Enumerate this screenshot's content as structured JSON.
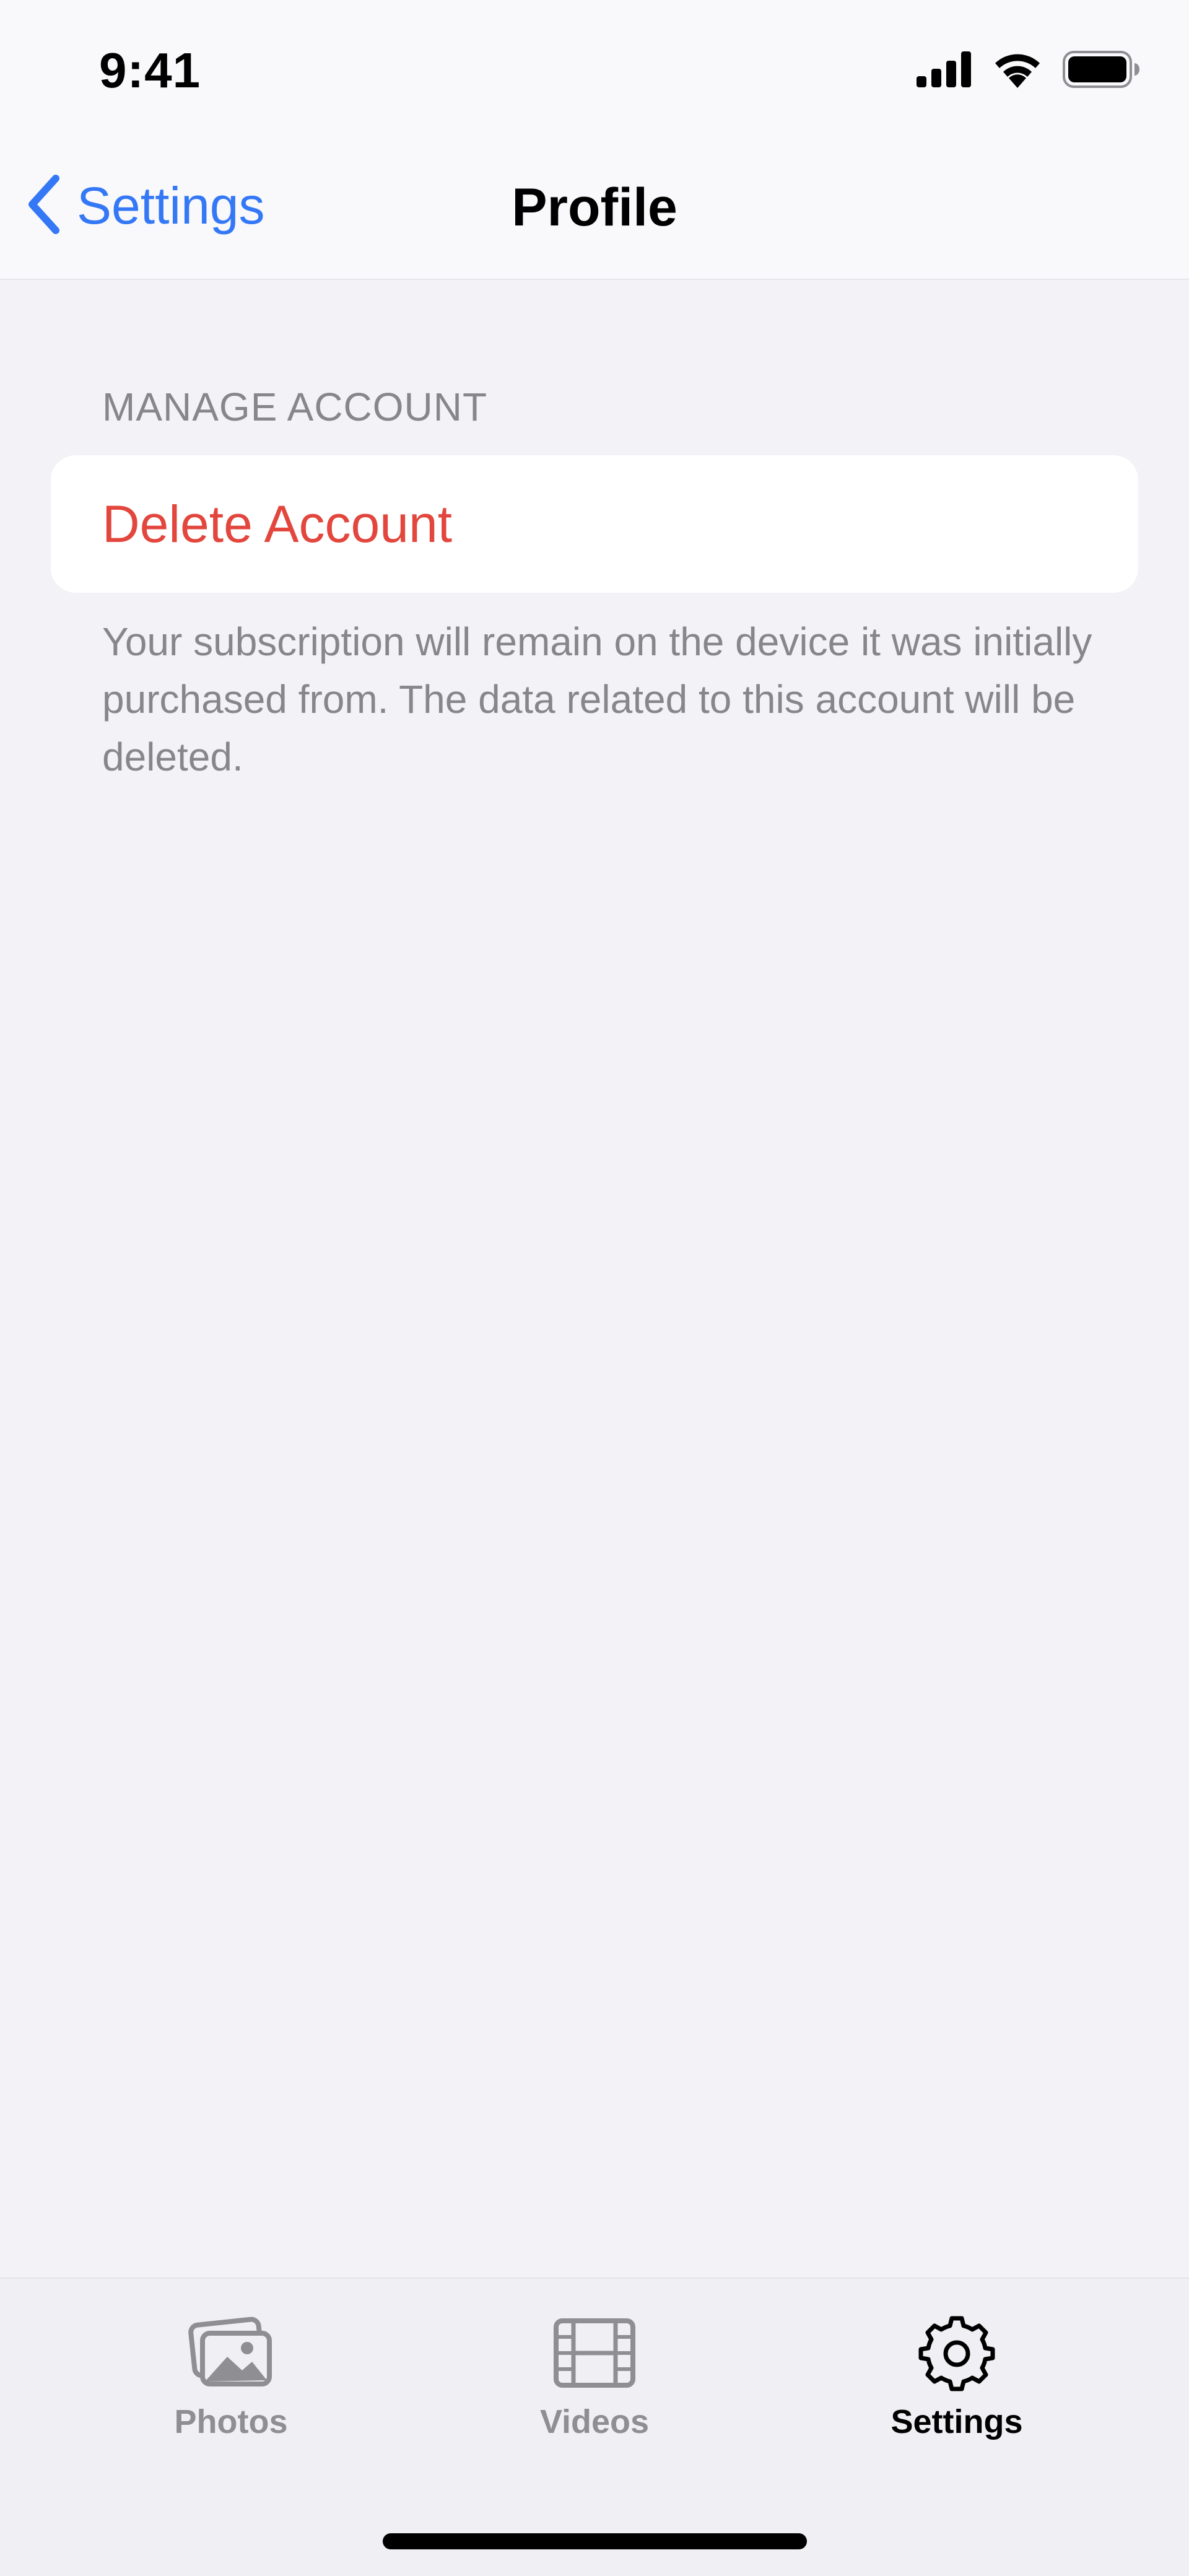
{
  "status_bar": {
    "time": "9:41",
    "icons": [
      "cellular-signal-icon",
      "wifi-icon",
      "battery-icon"
    ]
  },
  "nav": {
    "back_label": "Settings",
    "title": "Profile"
  },
  "section": {
    "header": "MANAGE ACCOUNT",
    "delete_label": "Delete Account",
    "footer": "Your subscription will remain on the device it was initially purchased from. The data related to this account will be deleted."
  },
  "tabs": [
    {
      "label": "Photos",
      "icon": "photos-icon",
      "active": false
    },
    {
      "label": "Videos",
      "icon": "film-icon",
      "active": false
    },
    {
      "label": "Settings",
      "icon": "gear-icon",
      "active": true
    }
  ],
  "colors": {
    "accent": "#3478F6",
    "destructive": "#E2463D",
    "secondary_text": "#86868B",
    "background": "#F2F2F7"
  }
}
